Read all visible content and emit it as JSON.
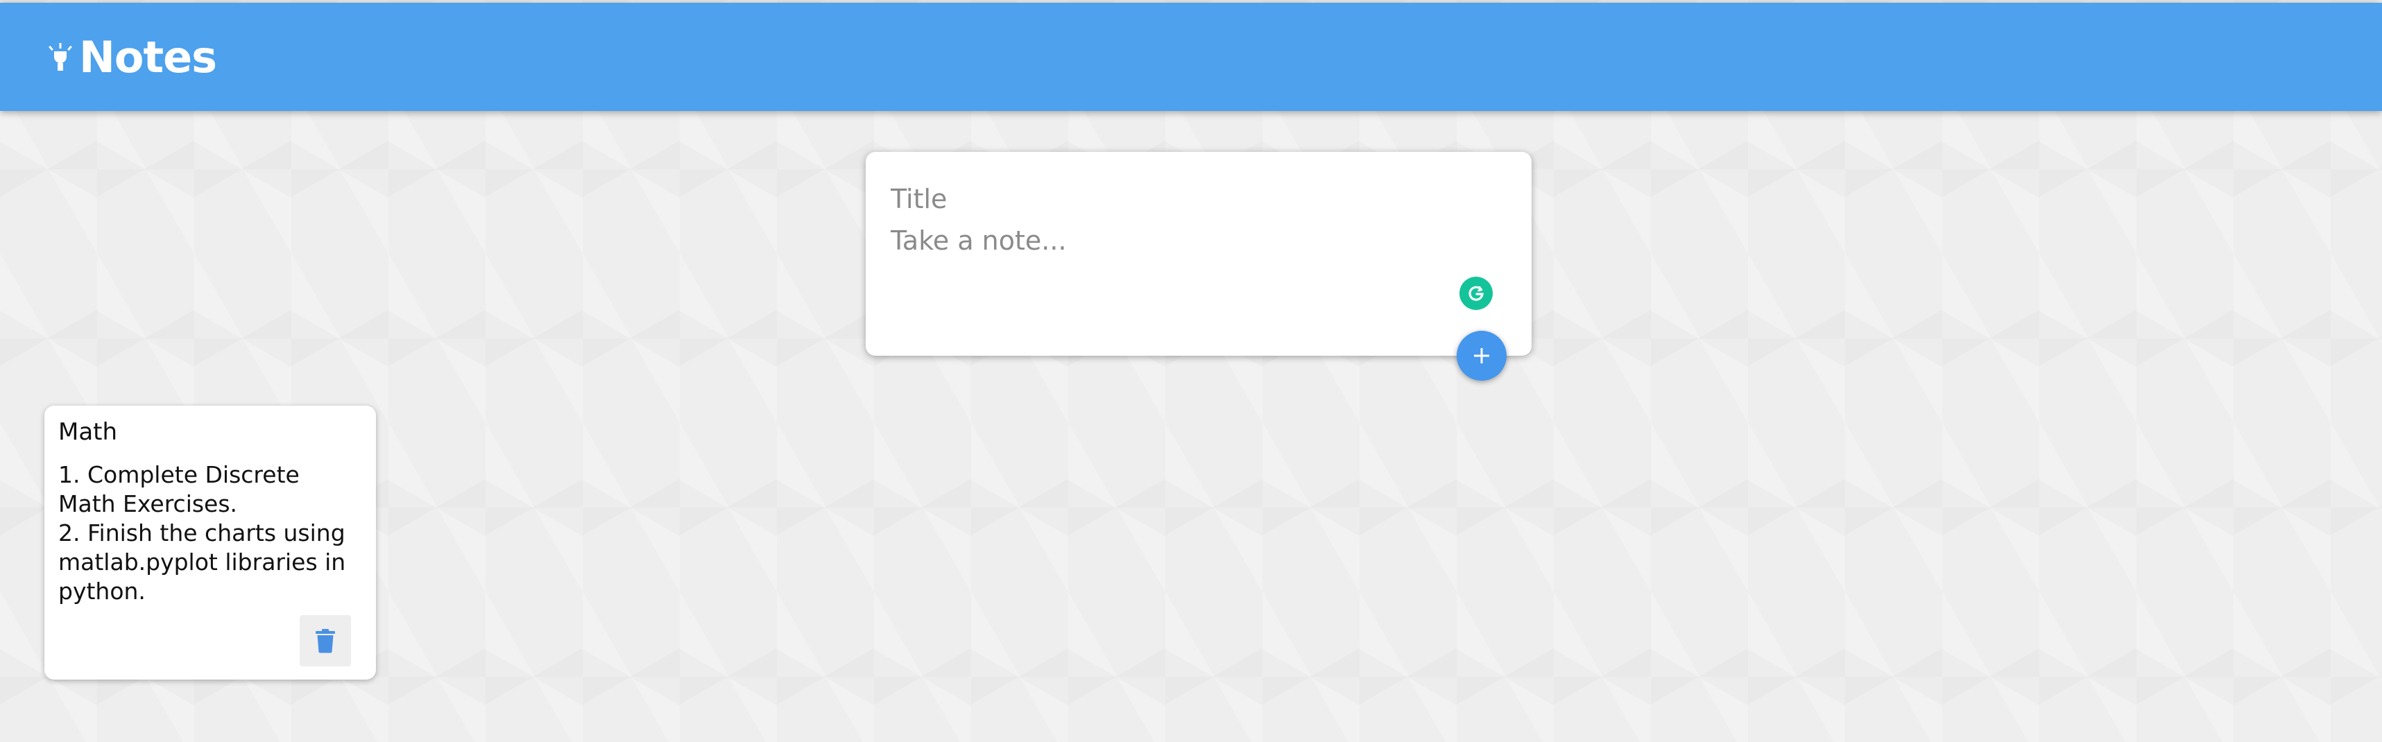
{
  "app": {
    "title": "Notes",
    "brand_icon": "lightbulb-icon",
    "header_color": "#4da1ed"
  },
  "create_note": {
    "title_placeholder": "Title",
    "title_value": "",
    "content_placeholder": "Take a note...",
    "content_value": "",
    "grammar_icon": "grammarly-icon",
    "add_icon": "plus-icon",
    "add_button_color": "#4596ed"
  },
  "notes": [
    {
      "title": "Math",
      "content": "1. Complete Discrete Math Exercises.\n2. Finish the charts using matlab.pyplot libraries in python.",
      "delete_icon": "trash-icon"
    }
  ]
}
